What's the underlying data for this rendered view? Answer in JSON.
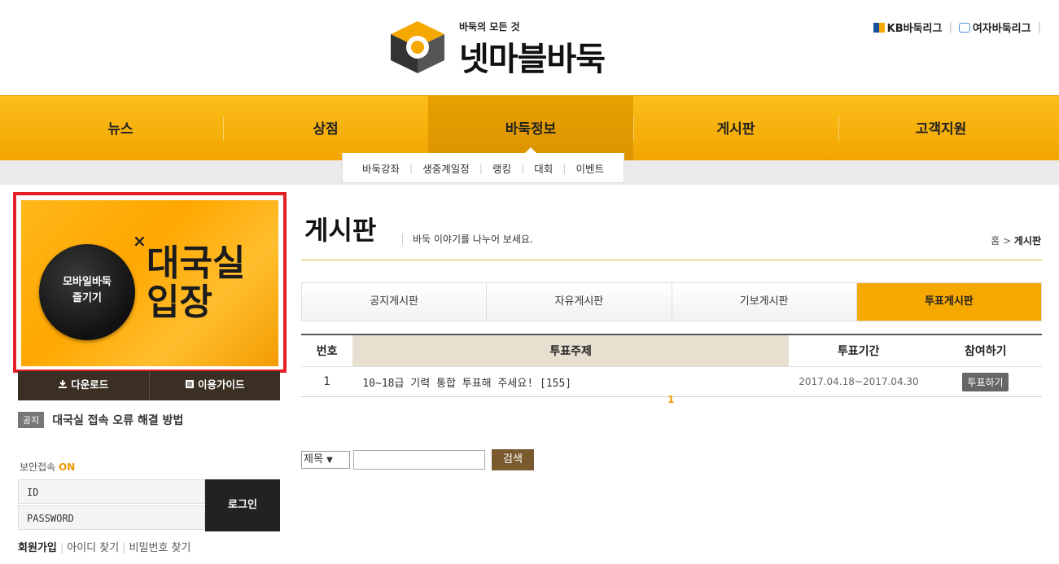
{
  "header": {
    "logo_tagline": "바둑의 모든 것",
    "logo_name": "넷마블바둑",
    "top_links": [
      "KB바둑리그",
      "여자바둑리그"
    ]
  },
  "nav": {
    "items": [
      "뉴스",
      "상점",
      "바둑정보",
      "게시판",
      "고객지원"
    ],
    "active": "바둑정보",
    "sub_items": [
      "바둑강좌",
      "생중계일정",
      "랭킹",
      "대회",
      "이벤트"
    ]
  },
  "banner": {
    "circle_line1": "모바일바둑",
    "circle_line2": "즐기기",
    "times": "×",
    "big_line1": "대국실",
    "big_line2": "입장",
    "download": "다운로드",
    "guide": "이용가이드"
  },
  "notice": {
    "badge": "공지",
    "text": "대국실 접속 오류 해결 방법"
  },
  "login": {
    "secure_label": "보안접속",
    "secure_state": "ON",
    "id_placeholder": "ID",
    "pw_placeholder": "PASSWORD",
    "login_button": "로그인",
    "join": "회원가입",
    "find_id": "아이디 찾기",
    "find_pw": "비밀번호 찾기"
  },
  "page": {
    "title": "게시판",
    "description": "바둑 이야기를 나누어 보세요.",
    "breadcrumb_home": "홈",
    "breadcrumb_sep": ">",
    "breadcrumb_current": "게시판"
  },
  "tabs": [
    "공지게시판",
    "자유게시판",
    "기보게시판",
    "투표게시판"
  ],
  "active_tab": "투표게시판",
  "table": {
    "headers": [
      "번호",
      "투표주제",
      "투표기간",
      "참여하기"
    ],
    "rows": [
      {
        "no": "1",
        "subject": "10~18급 기력 통합 투표해 주세요! [155]",
        "period": "2017.04.18~2017.04.30",
        "action": "투표하기"
      }
    ]
  },
  "pagination": {
    "current": "1"
  },
  "search": {
    "field": "제목",
    "button": "검색"
  },
  "colors": {
    "accent": "#f5a800",
    "highlight": "#e32028",
    "dark": "#3a2f22"
  }
}
